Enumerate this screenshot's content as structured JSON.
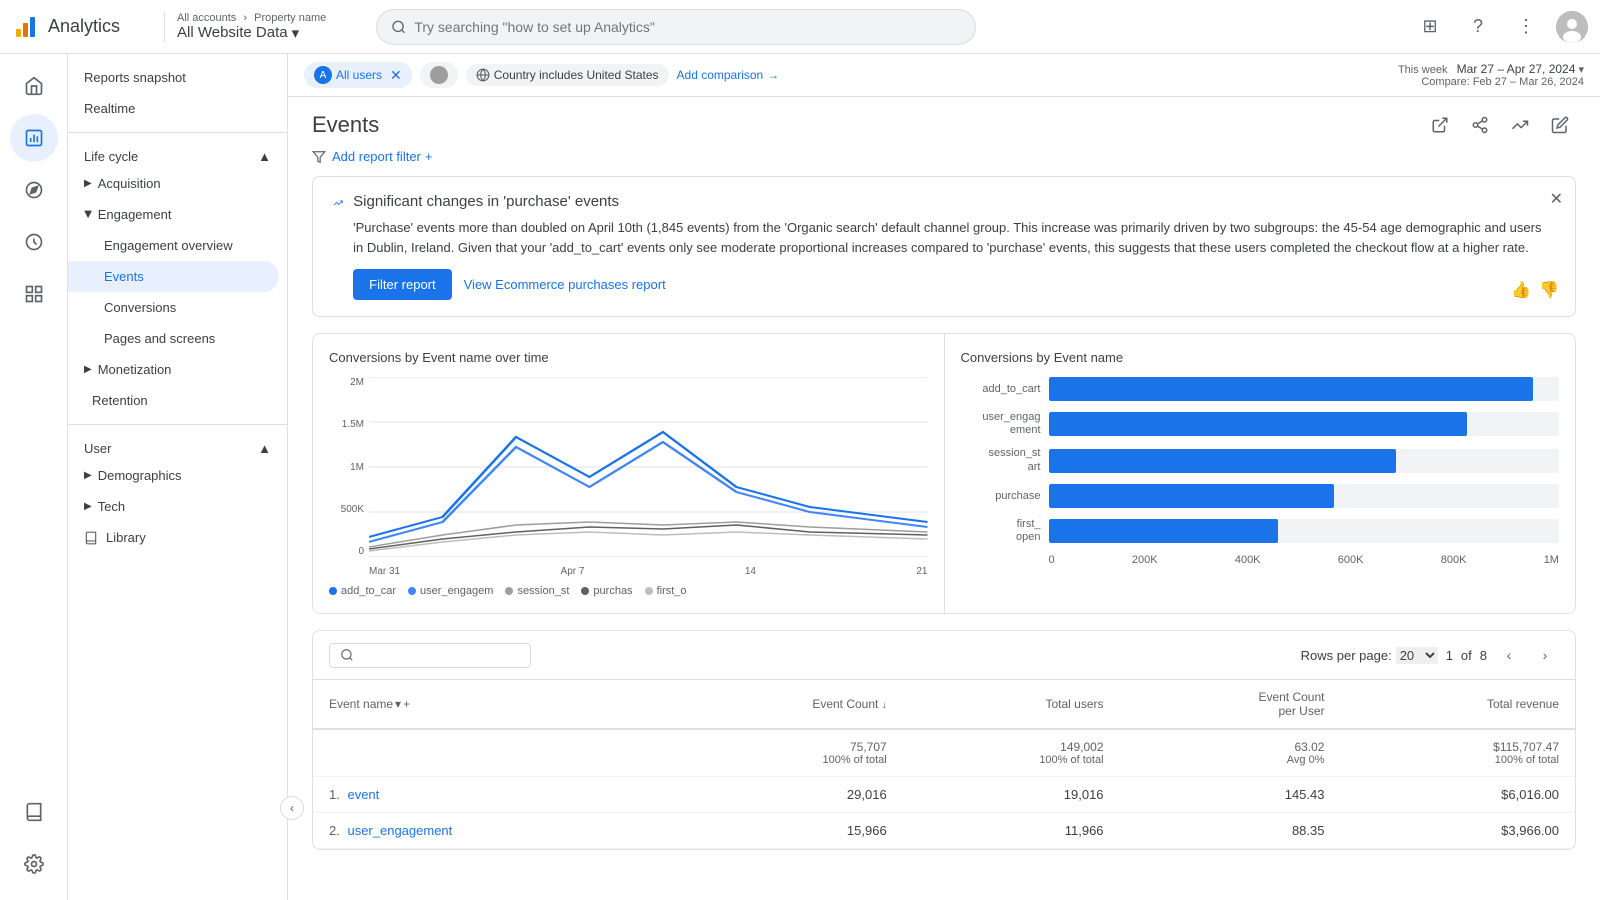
{
  "topbar": {
    "title": "Analytics",
    "breadcrumb_all_accounts": "All accounts",
    "breadcrumb_property": "Property name",
    "website_data": "All Website Data",
    "dropdown_arrow": "▾",
    "search_placeholder": "Try searching \"how to set up Analytics\""
  },
  "filter_bar": {
    "chip_all_users": "All users",
    "chip_segment": "",
    "chip_country": "Country includes United States",
    "add_comparison": "Add comparison",
    "date_label": "This week",
    "date_range": "Mar 27 – Apr 27, 2024",
    "compare_label": "Compare: Feb 27 – Mar 26, 2024"
  },
  "page": {
    "title": "Events",
    "add_filter": "Add report filter"
  },
  "insight": {
    "title": "Significant changes in 'purchase' events",
    "text": "'Purchase' events more than doubled on April 10th (1,845 events) from the 'Organic search' default channel group. This increase was primarily driven by two subgroups: the 45-54 age demographic and users in Dublin, Ireland. Given that your 'add_to_cart' events only see moderate proportional increases compared to 'purchase' events, this suggests that these users completed the checkout flow at a higher rate.",
    "filter_btn": "Filter report",
    "view_link": "View Ecommerce purchases report"
  },
  "line_chart": {
    "title": "Conversions by Event name over time",
    "y_labels": [
      "2M",
      "1.5M",
      "1M",
      "500K",
      "0"
    ],
    "x_labels": [
      "Mar 31",
      "Apr 7",
      "14",
      "21"
    ],
    "legend": [
      {
        "label": "add_to_car",
        "color": "#1a73e8"
      },
      {
        "label": "user_engagem",
        "color": "#4285f4"
      },
      {
        "label": "session_st",
        "color": "#5f6368"
      },
      {
        "label": "purchas",
        "color": "#34a853"
      },
      {
        "label": "first_o",
        "color": "#fbbc04"
      }
    ]
  },
  "bar_chart": {
    "title": "Conversions by Event name",
    "x_labels": [
      "0",
      "200K",
      "400K",
      "600K",
      "800K",
      "1M"
    ],
    "bars": [
      {
        "label": "add_to_cart",
        "value": 95
      },
      {
        "label": "user_engag\nement",
        "value": 82
      },
      {
        "label": "session_st\nart",
        "value": 68
      },
      {
        "label": "purchase",
        "value": 56
      },
      {
        "label": "first_\nopen",
        "value": 45
      }
    ]
  },
  "table": {
    "search_placeholder": "",
    "rows_per_page_label": "Rows per page:",
    "rows_per_page": "20",
    "page_current": "1",
    "page_total": "8",
    "columns": [
      "Event name",
      "Event Count ↓",
      "Total users",
      "Event Count per User",
      "Total revenue"
    ],
    "totals": {
      "event_count": "75,707",
      "event_count_pct": "100% of total",
      "total_users": "149,002",
      "total_users_pct": "100% of total",
      "event_per_user": "63.02",
      "event_per_user_pct": "Avg 0%",
      "total_revenue": "$115,707.47",
      "total_revenue_pct": "100% of total"
    },
    "rows": [
      {
        "num": "1.",
        "name": "event",
        "event_count": "29,016",
        "total_users": "19,016",
        "per_user": "145.43",
        "revenue": "$6,016.00"
      },
      {
        "num": "2.",
        "name": "user_engagement",
        "event_count": "15,966",
        "total_users": "11,966",
        "per_user": "88.35",
        "revenue": "$3,966.00"
      }
    ]
  },
  "nav": {
    "reports_snapshot": "Reports snapshot",
    "realtime": "Realtime",
    "lifecycle_label": "Life cycle",
    "acquisition": "Acquisition",
    "engagement": "Engagement",
    "engagement_overview": "Engagement overview",
    "events": "Events",
    "conversions": "Conversions",
    "pages_and_screens": "Pages and screens",
    "monetization": "Monetization",
    "retention": "Retention",
    "user_label": "User",
    "demographics": "Demographics",
    "tech": "Tech",
    "library": "Library"
  }
}
